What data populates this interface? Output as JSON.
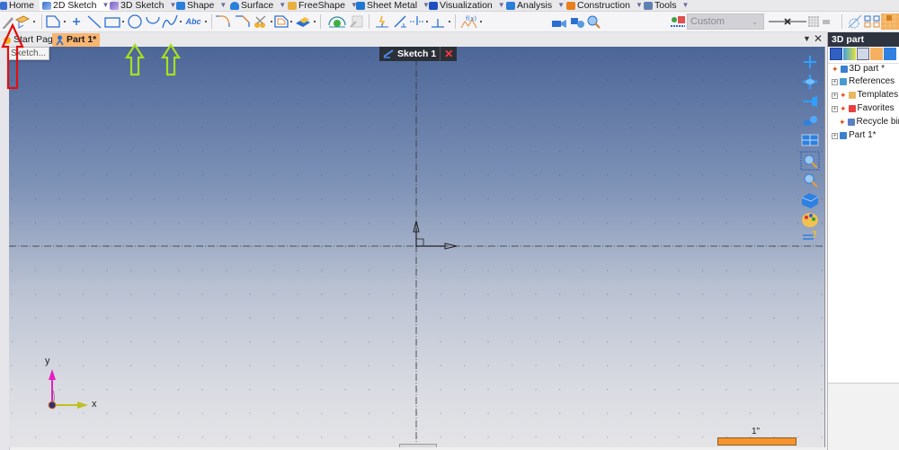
{
  "ribbon": {
    "tabs": [
      {
        "label": "Home",
        "icon": "home-icon",
        "color": "#3a6fd0"
      },
      {
        "label": "2D Sketch",
        "icon": "pencil-icon",
        "color": "#3a6fd0",
        "active": true
      },
      {
        "label": "3D Sketch",
        "icon": "pencil-3d-icon",
        "color": "#7a5fc0"
      },
      {
        "label": "Shape",
        "icon": "cube-icon",
        "color": "#2a7fd8"
      },
      {
        "label": "Surface",
        "icon": "surface-icon",
        "color": "#2a7fd8"
      },
      {
        "label": "FreeShape",
        "icon": "freeshape-icon",
        "color": "#e8b040"
      },
      {
        "label": "Sheet Metal",
        "icon": "sheet-metal-icon",
        "color": "#1f78d0"
      },
      {
        "label": "Visualization",
        "icon": "monitor-icon",
        "color": "#2050c0"
      },
      {
        "label": "Analysis",
        "icon": "analysis-icon",
        "color": "#2a7fd8"
      },
      {
        "label": "Construction",
        "icon": "construction-icon",
        "color": "#e88020"
      },
      {
        "label": "Tools",
        "icon": "tools-icon",
        "color": "#6080b0"
      }
    ]
  },
  "toolbar": {
    "style_dropdown": {
      "value": "Custom"
    },
    "tools": [
      "sketch",
      "sketch-plane",
      "polyline",
      "point",
      "line",
      "rectangle",
      "circle",
      "arc",
      "spline",
      "text",
      "fillet",
      "chamfer",
      "trim",
      "offset",
      "extrude-sketch",
      "close-sketch",
      "mirror-tool",
      "constraint",
      "dimension",
      "horizontal",
      "perpendicular",
      "equation",
      "view-1",
      "view-2",
      "view-3",
      "zoom-window",
      "style-palette",
      "line-style",
      "hatch",
      "snap",
      "mirror",
      "grid"
    ]
  },
  "tooltip": {
    "text": "Sketch..."
  },
  "doc_tabs": [
    {
      "label": "Start Page",
      "icon": "start-page-icon"
    },
    {
      "label": "Part 1*",
      "icon": "part-icon",
      "active": true
    }
  ],
  "viewport": {
    "sketch_badge": {
      "label": "Sketch 1"
    },
    "axis_labels": {
      "x": "x",
      "y": "y"
    },
    "scale_bar": {
      "label": "1\""
    }
  },
  "panel": {
    "title": "3D part",
    "tree": [
      {
        "label": "3D part *",
        "expander": false,
        "icon_color": "#3a7fd0"
      },
      {
        "label": "References",
        "expander": true,
        "icon_color": "#4a9ad0"
      },
      {
        "label": "Templates",
        "expander": true,
        "icon_color": "#e8b860"
      },
      {
        "label": "Favorites",
        "expander": true,
        "icon_color": "#e84040"
      },
      {
        "label": "Recycle bin",
        "expander": false,
        "icon_color": "#5a80c0"
      },
      {
        "label": "Part 1*",
        "expander": true,
        "icon_color": "#3a7fd0"
      }
    ]
  },
  "annotations": {
    "red_arrow_color": "#e01010",
    "green_arrow_color": "#a8e020"
  }
}
